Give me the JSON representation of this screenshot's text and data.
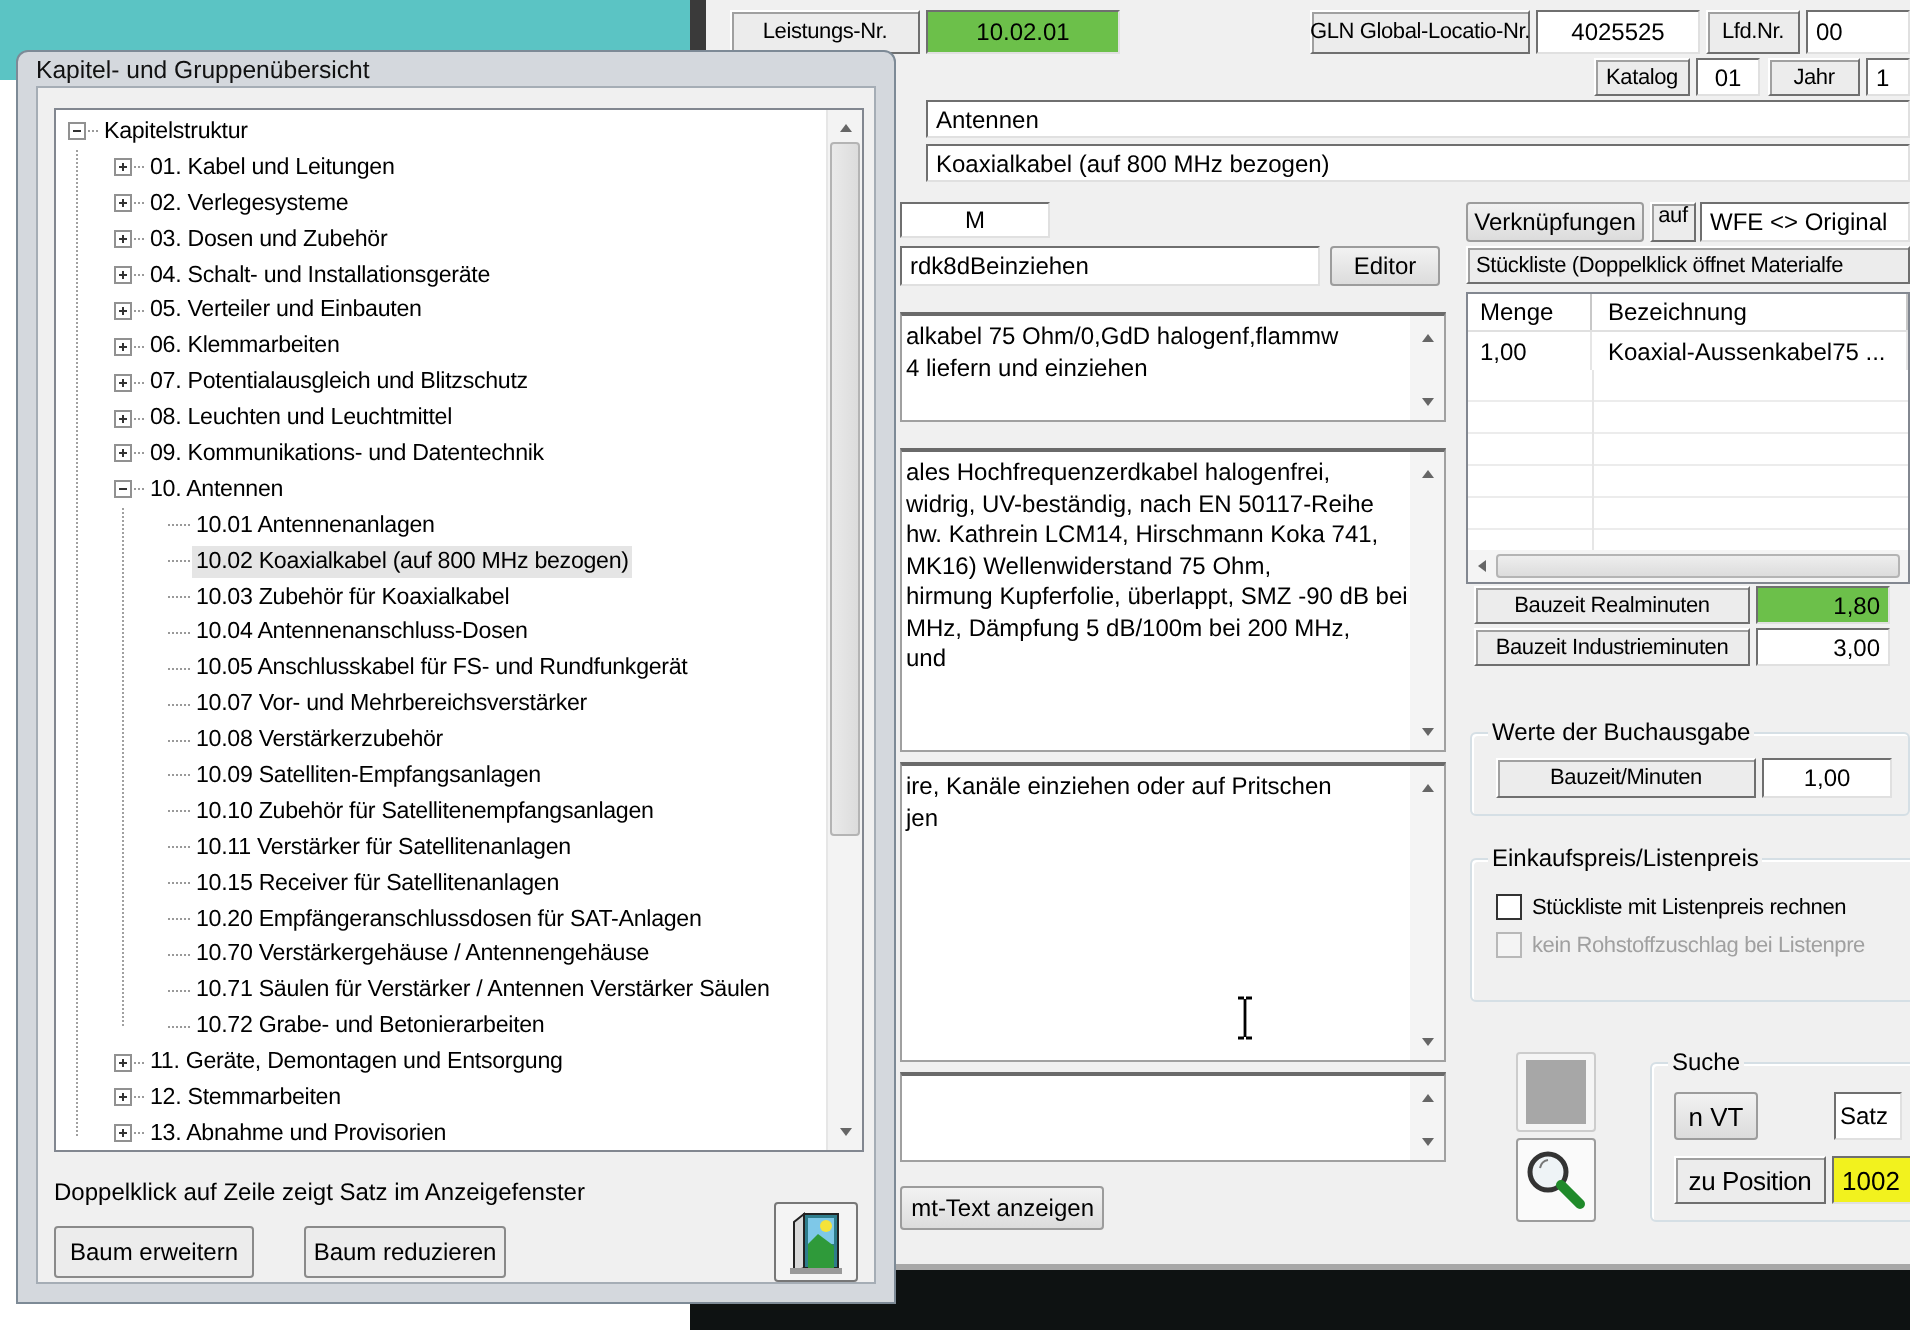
{
  "dialog": {
    "title": "Kapitel- und Gruppenübersicht",
    "tree": [
      {
        "label": "Kapitelstruktur",
        "expanded": true,
        "selected": false,
        "children": [
          {
            "label": "01. Kabel und Leitungen",
            "expanded": false,
            "selected": false
          },
          {
            "label": "02. Verlegesysteme",
            "expanded": false,
            "selected": false
          },
          {
            "label": "03. Dosen und Zubehör",
            "expanded": false,
            "selected": false
          },
          {
            "label": "04. Schalt- und Installationsgeräte",
            "expanded": false,
            "selected": false
          },
          {
            "label": "05. Verteiler und Einbauten",
            "expanded": false,
            "selected": false
          },
          {
            "label": "06. Klemmarbeiten",
            "expanded": false,
            "selected": false
          },
          {
            "label": "07. Potentialausgleich und Blitzschutz",
            "expanded": false,
            "selected": false
          },
          {
            "label": "08. Leuchten und Leuchtmittel",
            "expanded": false,
            "selected": false
          },
          {
            "label": "09. Kommunikations- und Datentechnik",
            "expanded": false,
            "selected": false
          },
          {
            "label": "10. Antennen",
            "expanded": true,
            "selected": false,
            "children": [
              {
                "label": "10.01 Antennenanlagen",
                "selected": false
              },
              {
                "label": "10.02 Koaxialkabel (auf 800 MHz bezogen)",
                "selected": true
              },
              {
                "label": "10.03 Zubehör für Koaxialkabel",
                "selected": false
              },
              {
                "label": "10.04 Antennenanschluss-Dosen",
                "selected": false
              },
              {
                "label": "10.05 Anschlusskabel für FS- und Rundfunkgerät",
                "selected": false
              },
              {
                "label": "10.07 Vor- und Mehrbereichsverstärker",
                "selected": false
              },
              {
                "label": "10.08 Verstärkerzubehör",
                "selected": false
              },
              {
                "label": "10.09 Satelliten-Empfangsanlagen",
                "selected": false
              },
              {
                "label": "10.10 Zubehör für Satellitenempfangsanlagen",
                "selected": false
              },
              {
                "label": "10.11 Verstärker für Satellitenanlagen",
                "selected": false
              },
              {
                "label": "10.15 Receiver für Satellitenanlagen",
                "selected": false
              },
              {
                "label": "10.20 Empfängeranschlussdosen für SAT-Anlagen",
                "selected": false
              },
              {
                "label": "10.70 Verstärkergehäuse / Antennengehäuse",
                "selected": false
              },
              {
                "label": "10.71 Säulen für Verstärker / Antennen Verstärker Säulen",
                "selected": false
              },
              {
                "label": "10.72 Grabe- und Betonierarbeiten",
                "selected": false
              }
            ]
          },
          {
            "label": "11. Geräte, Demontagen und Entsorgung",
            "expanded": false,
            "selected": false
          },
          {
            "label": "12. Stemmarbeiten",
            "expanded": false,
            "selected": false
          },
          {
            "label": "13. Abnahme und Provisorien",
            "expanded": false,
            "selected": false
          }
        ]
      }
    ],
    "hint": "Doppelklick auf Zeile zeigt Satz im Anzeigefenster",
    "buttons": [
      "Baum erweitern",
      "Baum reduzieren"
    ]
  },
  "header": {
    "service_no": {
      "label": "Leistungs-Nr.",
      "value": "10.02.01"
    },
    "gln": {
      "label": "GLN Global-Locatio-Nr.",
      "value": "4025525"
    },
    "serial_no": {
      "label": "Lfd.Nr.",
      "value": "00"
    },
    "catalog": {
      "label": "Katalog",
      "value": "01"
    },
    "year": {
      "label": "Jahr",
      "value": "1"
    },
    "group": "Antennen",
    "title": "Koaxialkabel (auf 800 MHz bezogen)"
  },
  "detail": {
    "unit": "M",
    "short_text": "rdk8dBeinziehen",
    "editor_button": "Editor",
    "text_1": "alkabel 75 Ohm/0,GdD halogenf,flammw\n4 liefern und einziehen",
    "text_2": "ales Hochfrequenzerdkabel halogenfrei,\nwidrig, UV-beständig, nach EN 50117-Reihe\nhw. Kathrein LCM14, Hirschmann Koka 741,\nMK16) Wellenwiderstand 75 Ohm,\nhirmung Kupferfolie, überlappt, SMZ -90 dB bei\nMHz, Dämpfung 5 dB/100m bei 200 MHz,\nund",
    "text_3": "ire, Kanäle einziehen oder auf Pritschen\njen",
    "full_text_button": "mt-Text anzeigen"
  },
  "links": {
    "button": "Verknüpfungen",
    "label": "auf",
    "dropdown": "WFE <> Original"
  },
  "parts_list": {
    "title": "Stückliste (Doppelklick öffnet Materialfe",
    "columns": [
      "Menge",
      "Bezeichnung"
    ],
    "rows": [
      [
        "1,00",
        "Koaxial-Aussenkabel75 ..."
      ]
    ]
  },
  "times": [
    {
      "label": "Bauzeit Realminuten",
      "value": "1,80"
    },
    {
      "label": "Bauzeit Industrieminuten",
      "value": "3,00"
    }
  ],
  "book_values": {
    "title": "Werte der Buchausgabe",
    "label": "Bauzeit/Minuten",
    "value": "1,00"
  },
  "purchase": {
    "title": "Einkaufspreis/Listenpreis",
    "options": [
      {
        "label": "Stückliste mit Listenpreis rechnen",
        "checked": false,
        "disabled": false
      },
      {
        "label": "kein Rohstoffzuschlag bei Listenpre",
        "checked": false,
        "disabled": true
      }
    ]
  },
  "search": {
    "title": "Suche",
    "button": "n VT",
    "record_field": "Satz",
    "position_label": "zu Position",
    "position_value": "1002"
  }
}
